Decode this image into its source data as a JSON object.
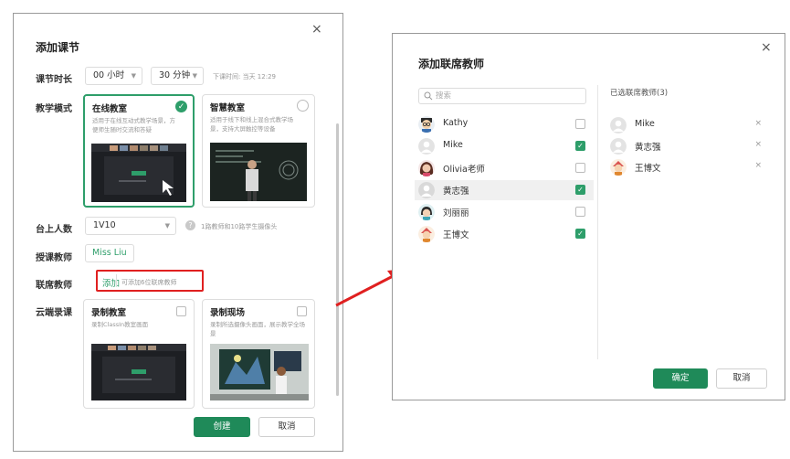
{
  "create_course": {
    "title": "添加课节",
    "close": "×",
    "duration": {
      "label": "课节时长",
      "hours": "00 小时",
      "minutes": "30 分钟",
      "end_time": "下课时间: 当天 12:29"
    },
    "mode": {
      "label": "教学模式",
      "online": {
        "title": "在线教室",
        "desc": "适用于在线互动式教学场景，方便师生随时交流和答疑"
      },
      "smart": {
        "title": "智慧教室",
        "desc": "适用于线下和线上混合式教学场景，支持大屏触控等设备"
      }
    },
    "stage": {
      "label": "台上人数",
      "value": "1V10",
      "hint": "1路教师和10路学生摄像头"
    },
    "teacher": {
      "label": "授课教师",
      "value": "Miss Liu"
    },
    "co_teacher": {
      "label": "联席教师",
      "add": "添加",
      "hint": "可添加6位联席教师"
    },
    "recording": {
      "label": "云端录课",
      "classroom": {
        "title": "录制教室",
        "desc": "录制ClassIn教室画面"
      },
      "scene": {
        "title": "录制现场",
        "desc": "录制所选摄像头画面，展示教学全场景"
      }
    },
    "create_button": "创建",
    "cancel_button": "取消"
  },
  "co_teacher_dialog": {
    "title": "添加联席教师",
    "close": "×",
    "search_placeholder": "搜索",
    "teachers": [
      {
        "name": "Kathy",
        "checked": false
      },
      {
        "name": "Mike",
        "checked": true
      },
      {
        "name": "Olivia老师",
        "checked": false
      },
      {
        "name": "黄志强",
        "checked": true
      },
      {
        "name": "刘丽丽",
        "checked": false
      },
      {
        "name": "王博文",
        "checked": true
      }
    ],
    "selected_title": "已选联席教师(3)",
    "selected": [
      {
        "name": "Mike"
      },
      {
        "name": "黄志强"
      },
      {
        "name": "王博文"
      }
    ],
    "remove": "×",
    "confirm_button": "确定",
    "cancel_button": "取消"
  },
  "check_mark": "✓",
  "colors": {
    "accent": "#1f8a59",
    "highlight": "#e02020"
  }
}
